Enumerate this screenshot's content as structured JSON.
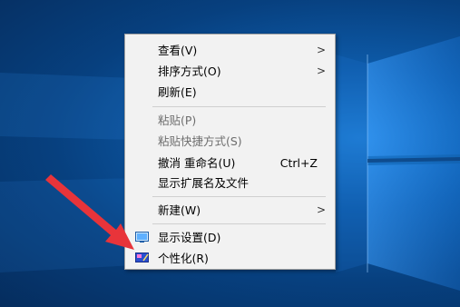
{
  "desktop": {
    "background_color": "#0b4f99",
    "accent_color": "#2a8cf0"
  },
  "menu": {
    "items": [
      {
        "label": "查看(V)",
        "submenu": true,
        "enabled": true
      },
      {
        "label": "排序方式(O)",
        "submenu": true,
        "enabled": true
      },
      {
        "label": "刷新(E)",
        "submenu": false,
        "enabled": true
      },
      {
        "label": "粘贴(P)",
        "submenu": false,
        "enabled": false
      },
      {
        "label": "粘贴快捷方式(S)",
        "submenu": false,
        "enabled": false
      },
      {
        "label": "撤消 重命名(U)",
        "shortcut": "Ctrl+Z",
        "submenu": false,
        "enabled": true
      },
      {
        "label": "显示扩展名及文件",
        "submenu": false,
        "enabled": true
      },
      {
        "label": "新建(W)",
        "submenu": true,
        "enabled": true
      },
      {
        "label": "显示设置(D)",
        "icon": "display-settings-icon",
        "submenu": false,
        "enabled": true
      },
      {
        "label": "个性化(R)",
        "icon": "personalize-icon",
        "submenu": false,
        "enabled": true
      }
    ],
    "arrow_glyph": ">"
  },
  "annotation": {
    "color": "#e8343a",
    "target": "personalize"
  }
}
